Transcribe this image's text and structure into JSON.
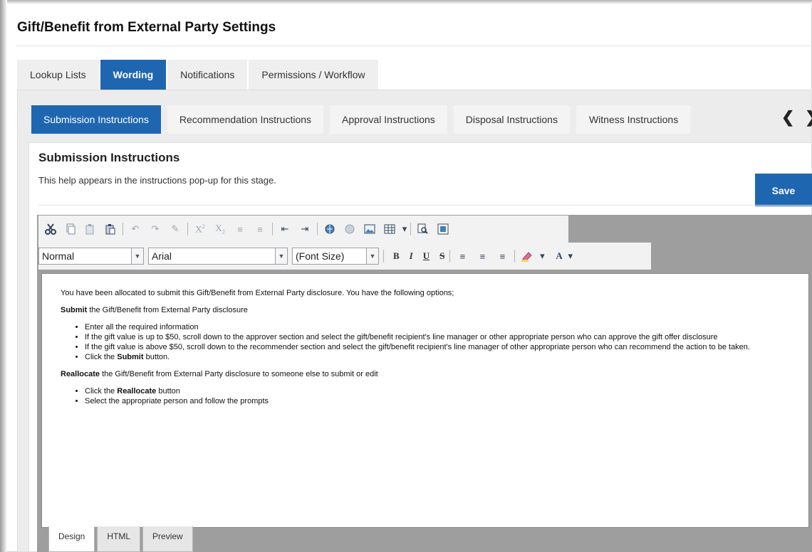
{
  "page": {
    "title": "Gift/Benefit from External Party Settings"
  },
  "main_tabs": [
    {
      "label": "Lookup Lists",
      "active": false
    },
    {
      "label": "Wording",
      "active": true
    },
    {
      "label": "Notifications",
      "active": false
    },
    {
      "label": "Permissions / Workflow",
      "active": false
    }
  ],
  "sub_tabs": [
    {
      "label": "Submission Instructions",
      "active": true
    },
    {
      "label": "Recommendation Instructions",
      "active": false
    },
    {
      "label": "Approval Instructions",
      "active": false
    },
    {
      "label": "Disposal Instructions",
      "active": false
    },
    {
      "label": "Witness Instructions",
      "active": false
    }
  ],
  "scroll": {
    "prev": "❮",
    "next": "❯"
  },
  "section": {
    "title": "Submission Instructions",
    "description": "This help appears in the instructions pop-up for this stage.",
    "save_label": "Save"
  },
  "toolbar": {
    "format_value": "Normal",
    "font_value": "Arial",
    "size_value": "(Font Size)",
    "bold": "B",
    "italic": "I",
    "underline": "U",
    "strike": "S",
    "font_color": "A"
  },
  "content": {
    "intro": "You have been allocated to submit this Gift/Benefit from External Party disclosure. You have the following options;",
    "submit_heading_bold": "Submit",
    "submit_heading_rest": " the Gift/Benefit from External Party disclosure",
    "submit_items": [
      "Enter all the required information",
      "If the gift value is up to $50, scroll down to the approver section and select the gift/benefit recipient's line manager or other appropriate person who can approve the gift offer disclosure",
      "If the gift value is above $50, scroll down to the recommender section and select the gift/benefit recipient's line manager of other appropriate person who can recommend the action to be taken."
    ],
    "click_prefix": "Click the ",
    "click_submit_bold": "Submit",
    "click_submit_suffix": " button.",
    "reallocate_heading_bold": "Reallocate",
    "reallocate_heading_rest": " the Gift/Benefit from External Party disclosure to someone else to submit or edit",
    "click_reallocate_bold": "Reallocate",
    "click_reallocate_suffix": " button",
    "reallocate_item2": "Select the appropriate person and follow the prompts"
  },
  "editor_modes": [
    {
      "label": "Design",
      "active": true
    },
    {
      "label": "HTML",
      "active": false
    },
    {
      "label": "Preview",
      "active": false
    }
  ],
  "colors": {
    "accent": "#1f66b1",
    "panel": "#ececec"
  }
}
